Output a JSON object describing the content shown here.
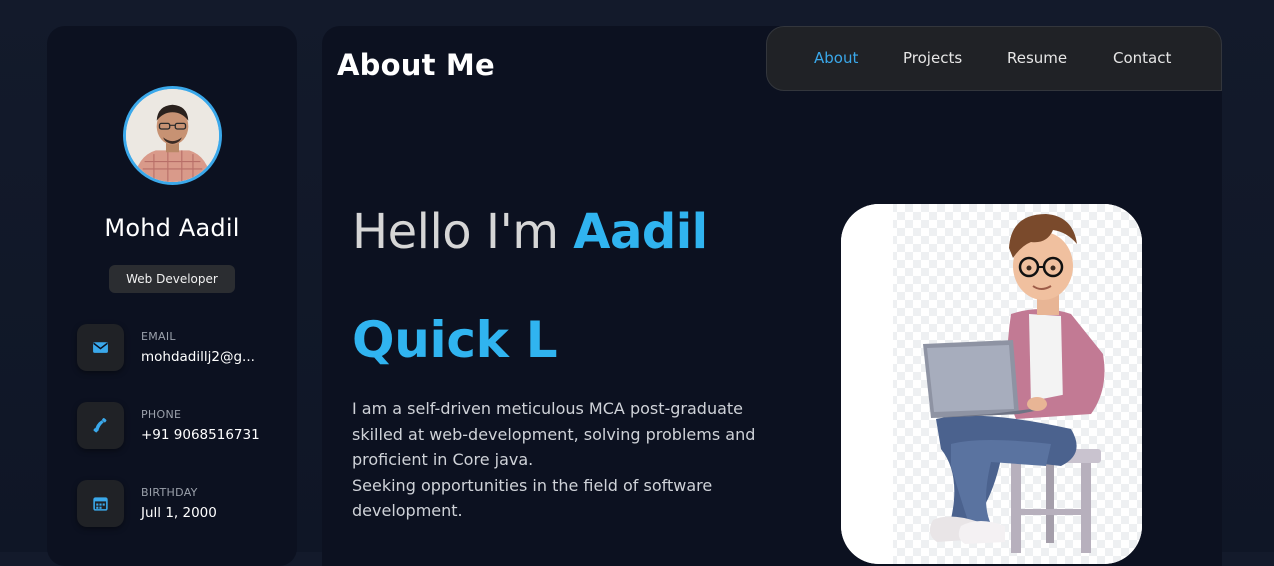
{
  "profile": {
    "name": "Mohd Aadil",
    "role": "Web Developer",
    "avatar_icon": "profile-photo",
    "accent": "#3aa8ea"
  },
  "contacts": [
    {
      "label": "EMAIL",
      "value": "mohdadillj2@g...",
      "icon": "mail-icon"
    },
    {
      "label": "PHONE",
      "value": "+91 9068516731",
      "icon": "phone-icon"
    },
    {
      "label": "BIRTHDAY",
      "value": "Jull 1, 2000",
      "icon": "calendar-icon"
    }
  ],
  "main": {
    "title": "About Me",
    "greeting_prefix": "Hello I'm ",
    "greeting_name": "Aadil",
    "typed_text": "Quick L",
    "bio": "I am a self-driven meticulous MCA post-graduate skilled at web-development, solving problems and proficient in Core java.\nSeeking opportunities in the field of software development."
  },
  "nav": {
    "items": [
      {
        "label": "About",
        "active": true
      },
      {
        "label": "Projects",
        "active": false
      },
      {
        "label": "Resume",
        "active": false
      },
      {
        "label": "Contact",
        "active": false
      }
    ]
  },
  "colors": {
    "background": "#111827",
    "card": "#0c1120",
    "highlight": "#30b4f0",
    "nav_bg": "#202226"
  }
}
